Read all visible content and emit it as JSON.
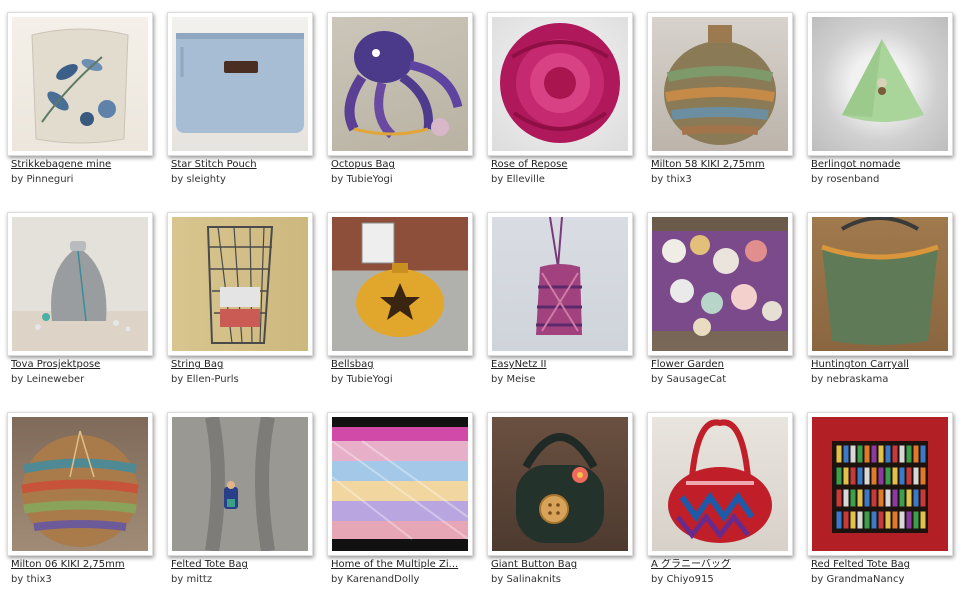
{
  "items": [
    {
      "title": "Strikkebagene mine",
      "by": "by",
      "author": "Pinneguri"
    },
    {
      "title": "Star Stitch Pouch",
      "by": "by",
      "author": "sleighty"
    },
    {
      "title": "Octopus Bag",
      "by": "by",
      "author": "TubieYogi"
    },
    {
      "title": "Rose of Repose",
      "by": "by",
      "author": "Elleville"
    },
    {
      "title": "Milton 58 KIKI 2,75mm",
      "by": "by",
      "author": "thix3"
    },
    {
      "title": "Berlingot nomade",
      "by": "by",
      "author": "rosenband"
    },
    {
      "title": "Tova Prosjektpose",
      "by": "by",
      "author": "Leineweber"
    },
    {
      "title": "String Bag",
      "by": "by",
      "author": "Ellen-Purls"
    },
    {
      "title": "Bellsbag",
      "by": "by",
      "author": "TubieYogi"
    },
    {
      "title": "EasyNetz II",
      "by": "by",
      "author": "Meise"
    },
    {
      "title": "Flower Garden",
      "by": "by",
      "author": "SausageCat"
    },
    {
      "title": "Huntington Carryall",
      "by": "by",
      "author": "nebraskama"
    },
    {
      "title": "Milton 06 KIKI 2,75mm",
      "by": "by",
      "author": "thix3"
    },
    {
      "title": "Felted Tote Bag",
      "by": "by",
      "author": "mittz"
    },
    {
      "title": "Home of the Multiple Zi...",
      "by": "by",
      "author": "KarenandDolly"
    },
    {
      "title": "Giant Button Bag",
      "by": "by",
      "author": "Salinaknits"
    },
    {
      "title": "A グラニーバッグ",
      "by": "by",
      "author": "Chiyo915"
    },
    {
      "title": "Red Felted Tote Bag",
      "by": "by",
      "author": "GrandmaNancy"
    }
  ]
}
